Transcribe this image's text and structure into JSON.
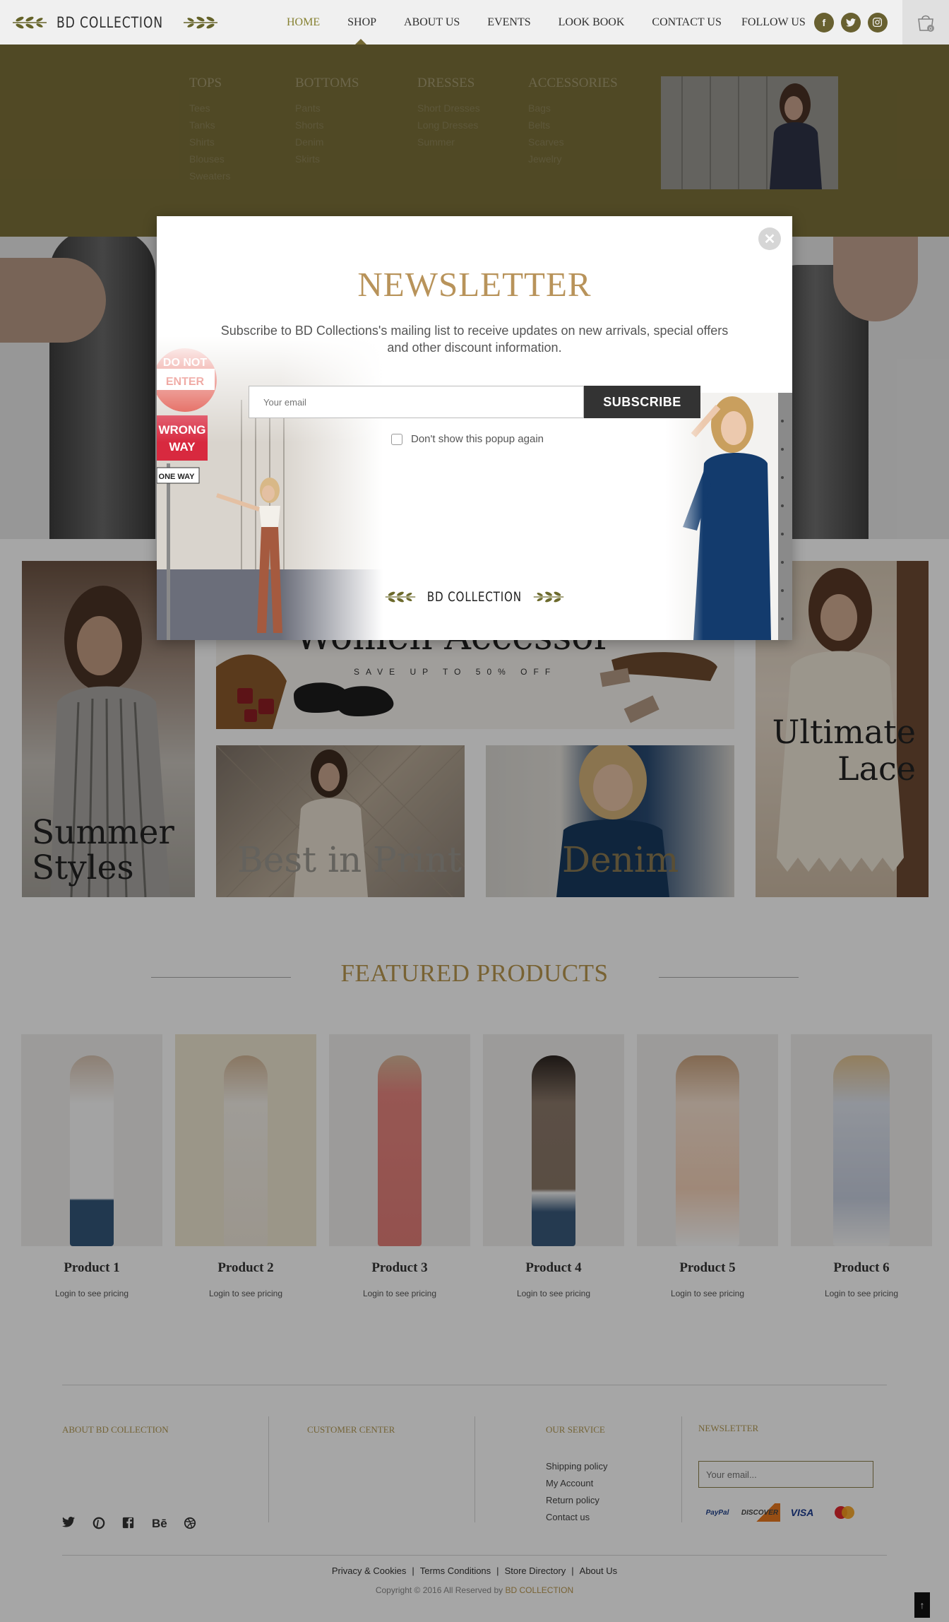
{
  "header": {
    "logo_text": "BD COLLECTION",
    "nav": [
      "HOME",
      "SHOP",
      "ABOUT US",
      "EVENTS",
      "LOOK BOOK",
      "CONTACT US"
    ],
    "active_nav": "HOME",
    "follow_label": "FOLLOW US",
    "social_icons": [
      "facebook-icon",
      "twitter-icon",
      "instagram-icon"
    ],
    "cart_count": "0"
  },
  "mega_menu": {
    "columns": [
      {
        "title": "TOPS",
        "items": [
          "Tees",
          "Tanks",
          "Shirts",
          "Blouses",
          "Sweaters"
        ]
      },
      {
        "title": "BOTTOMS",
        "items": [
          "Pants",
          "Shorts",
          "Denim",
          "Skirts"
        ]
      },
      {
        "title": "DRESSES",
        "items": [
          "Short Dresses",
          "Long Dresses",
          "Summer"
        ]
      },
      {
        "title": "ACCESSORIES",
        "items": [
          "Bags",
          "Belts",
          "Scarves",
          "Jewelry"
        ]
      }
    ]
  },
  "categories": {
    "summer": "Summer Styles",
    "accessories": "Women Accessor",
    "accessories_sub": "SAVE UP TO 50% OFF",
    "print": "Best in Print",
    "denim": "Denim",
    "lace": "Ultimate Lace"
  },
  "featured": {
    "title": "FEATURED PRODUCTS",
    "products": [
      {
        "name": "Product 1",
        "price": "Login to see pricing"
      },
      {
        "name": "Product 2",
        "price": "Login to see pricing"
      },
      {
        "name": "Product 3",
        "price": "Login to see pricing"
      },
      {
        "name": "Product 4",
        "price": "Login to see pricing"
      },
      {
        "name": "Product 5",
        "price": "Login to see pricing"
      },
      {
        "name": "Product 6",
        "price": "Login to see pricing"
      }
    ]
  },
  "footer": {
    "about_title": "ABOUT BD COLLECTION",
    "customer_title": "CUSTOMER CENTER",
    "service_title": "OUR SERVICE",
    "service_links": [
      "Shipping policy",
      "My Account",
      "Return policy",
      "Contact us"
    ],
    "newsletter_title": "NEWSLETTER",
    "email_placeholder": "Your email...",
    "payments": [
      "PayPal",
      "DISCOVER",
      "VISA",
      "MasterCard"
    ],
    "social_icons": [
      "twitter-icon",
      "pinterest-icon",
      "facebook-icon",
      "behance-icon",
      "dribbble-icon"
    ],
    "bottom_links": [
      "Privacy & Cookies",
      "Terms Conditions",
      "Store Directory",
      "About Us"
    ],
    "copyright_prefix": "Copyright © 2016 All Reserved by ",
    "copyright_brand": "BD COLLECTION"
  },
  "popup": {
    "title": "NEWSLETTER",
    "description": "Subscribe to BD Collections's mailing list to receive updates on new arrivals, special offers and other discount information.",
    "email_placeholder": "Your email",
    "subscribe_label": "SUBSCRIBE",
    "dont_show_label": "Don't show this popup again",
    "logo_text": "BD COLLECTION",
    "street_signs": [
      "DO NOT ENTER",
      "WRONG WAY",
      "ONE WAY"
    ]
  },
  "colors": {
    "accent_gold": "#b8935a",
    "olive": "#7c7039",
    "dark_button": "#333333"
  }
}
